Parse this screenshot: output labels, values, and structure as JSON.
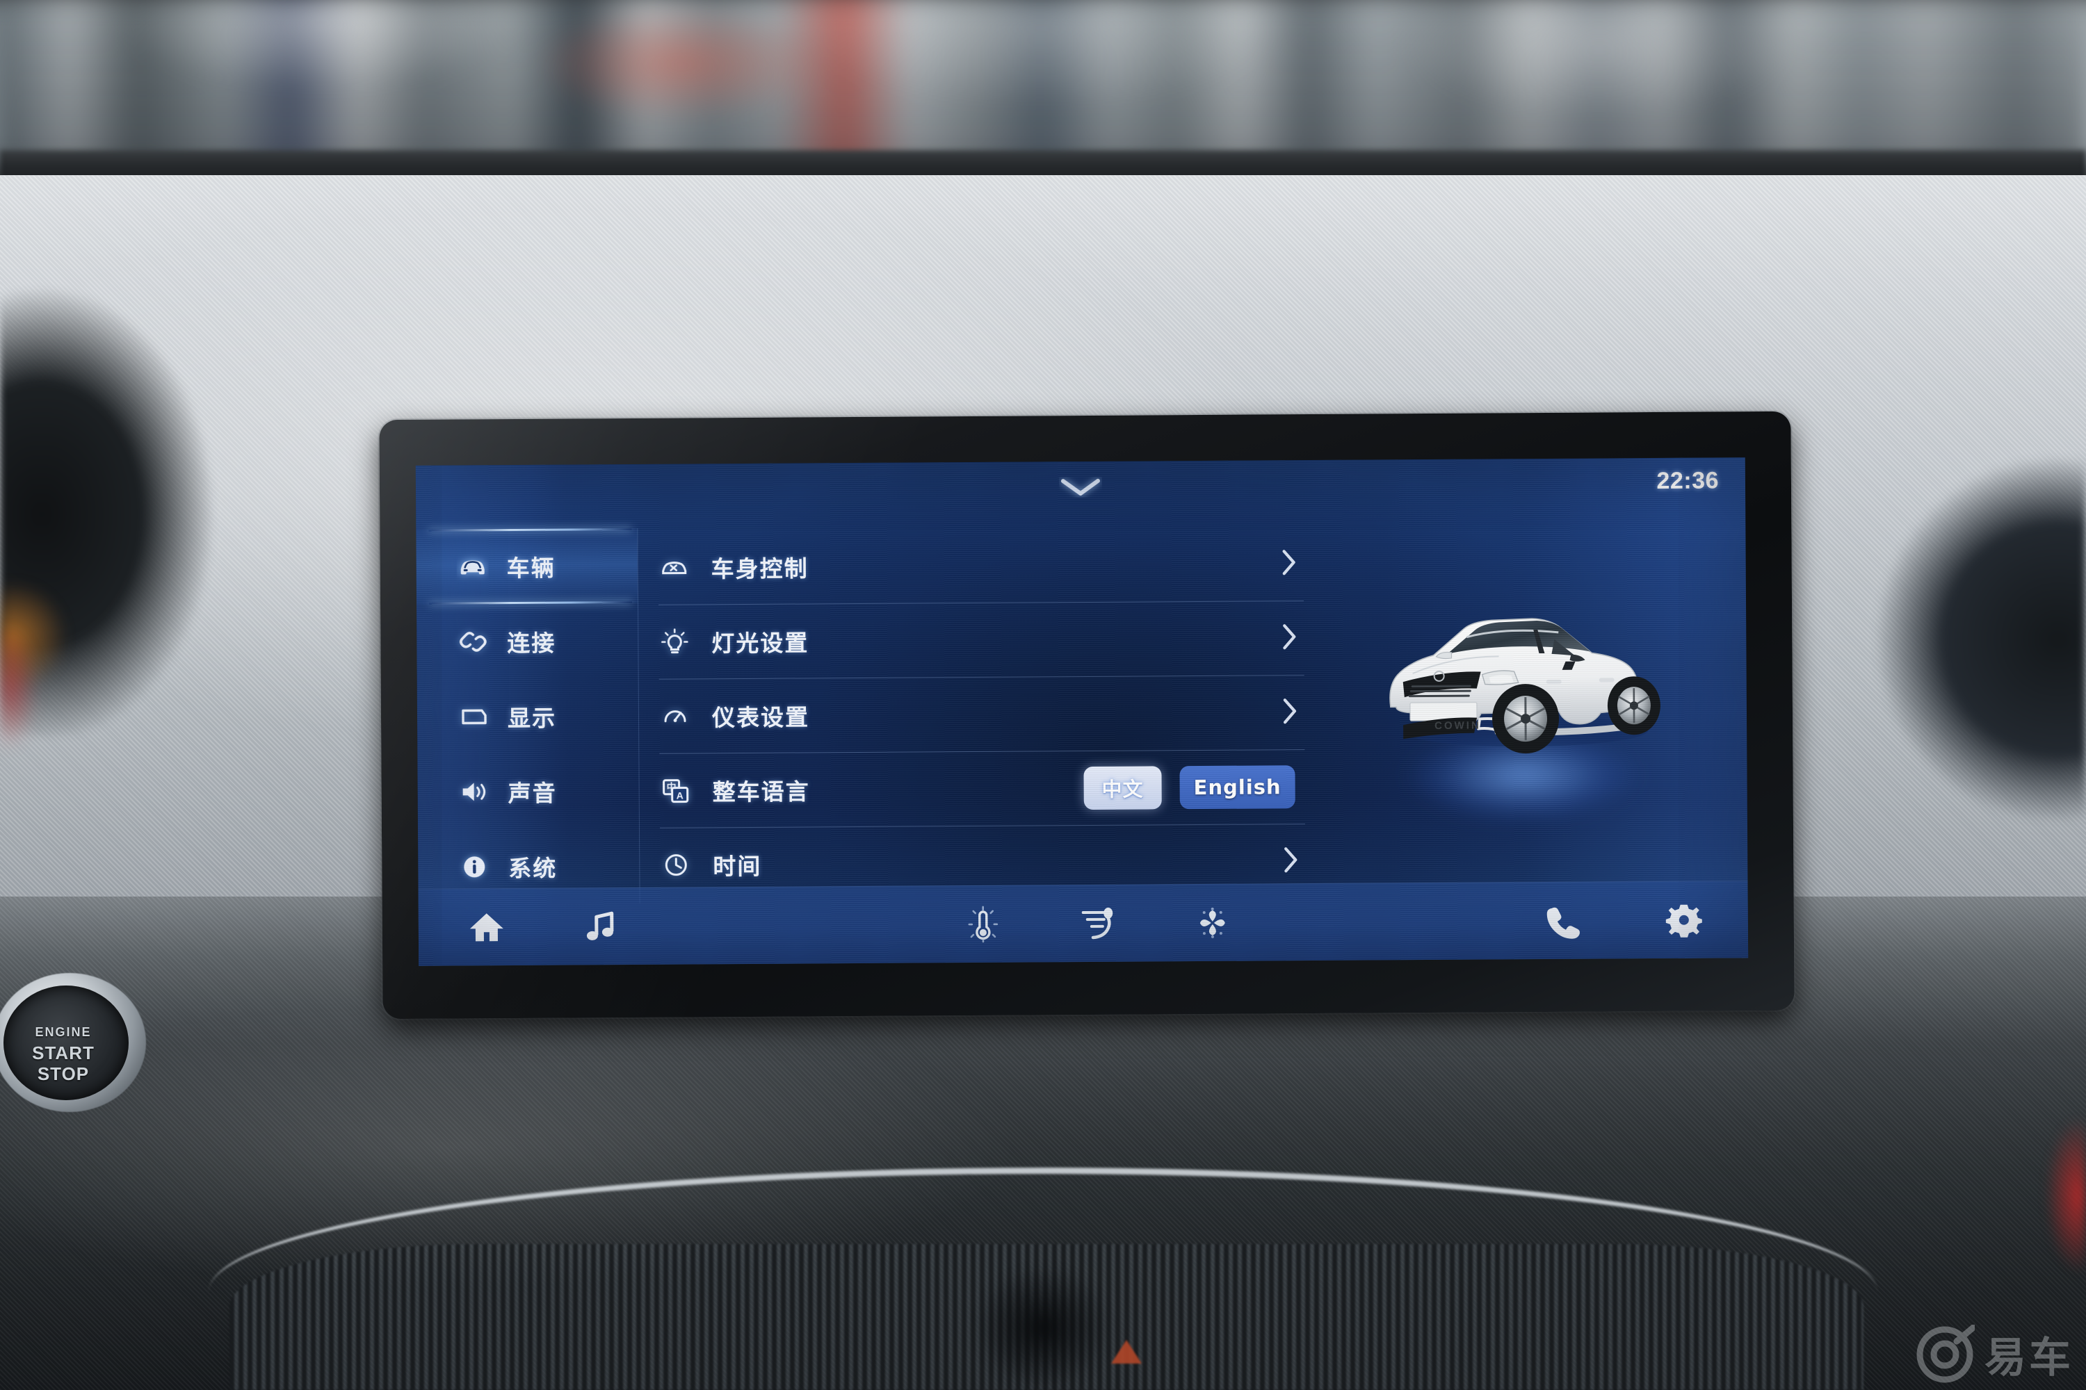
{
  "device": {
    "name": "car-infotainment-head-unit",
    "screen_brand_car_badge": "COWIN"
  },
  "status_bar": {
    "pull_handle_icon": "chevron-down-icon",
    "time": "22:36"
  },
  "sidebar": {
    "items": [
      {
        "label": "车辆",
        "icon": "car-front-icon",
        "active": true
      },
      {
        "label": "连接",
        "icon": "link-chain-icon",
        "active": false
      },
      {
        "label": "显示",
        "icon": "display-screen-icon",
        "active": false
      },
      {
        "label": "声音",
        "icon": "speaker-volume-icon",
        "active": false
      },
      {
        "label": "系统",
        "icon": "info-circle-icon",
        "active": false
      }
    ]
  },
  "settings_list": {
    "rows": [
      {
        "label": "车身控制",
        "icon": "car-body-control-icon",
        "accessory": "chevron-right-icon"
      },
      {
        "label": "灯光设置",
        "icon": "light-bulb-icon",
        "accessory": "chevron-right-icon"
      },
      {
        "label": "仪表设置",
        "icon": "gauge-cluster-icon",
        "accessory": "chevron-right-icon"
      },
      {
        "label": "整车语言",
        "icon": "translate-language-icon",
        "accessory": "segmented-toggle"
      },
      {
        "label": "时间",
        "icon": "clock-icon",
        "accessory": "chevron-right-icon"
      }
    ],
    "language_toggle": {
      "selected_label": "中文",
      "other_label": "English",
      "selected_value": "中文"
    }
  },
  "dock": {
    "items": [
      {
        "icon": "home-icon",
        "name": "home"
      },
      {
        "icon": "music-note-icon",
        "name": "media"
      },
      {
        "icon": "thermometer-icon",
        "name": "temperature"
      },
      {
        "icon": "airflow-seat-icon",
        "name": "airflow"
      },
      {
        "icon": "fan-icon",
        "name": "fan"
      },
      {
        "icon": "phone-icon",
        "name": "phone"
      },
      {
        "icon": "gear-icon",
        "name": "settings"
      }
    ]
  },
  "engine_button": {
    "line1": "ENGINE",
    "line2": "START",
    "line3": "STOP"
  },
  "watermark": {
    "logo_icon": "yiche-circle-logo-icon",
    "text": "易车"
  },
  "colors": {
    "lcd_blue_dark": "#102450",
    "lcd_blue_light": "#1b3a74",
    "accent_blue": "#4a74cf",
    "selected_chip": "#e6ecfa",
    "text_primary": "#f2f6fd"
  }
}
